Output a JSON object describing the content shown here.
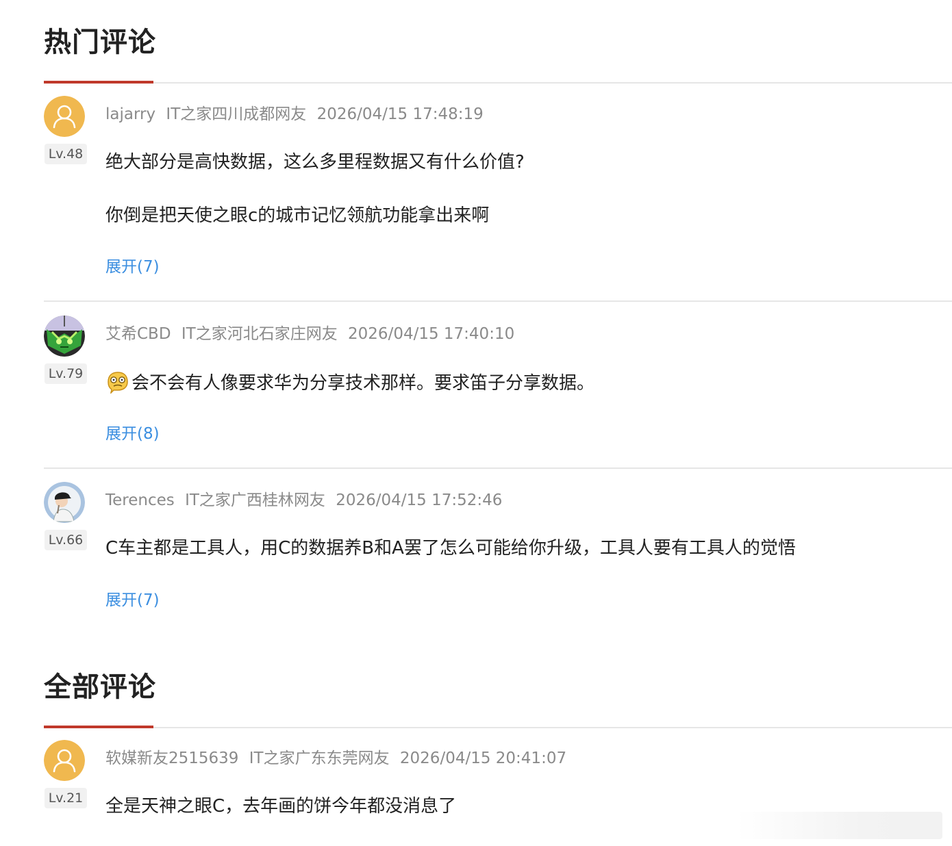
{
  "hot_section": {
    "title": "热门评论"
  },
  "all_section": {
    "title": "全部评论"
  },
  "colors": {
    "accent": "#c0392b",
    "link": "#3b8ee0",
    "meta": "#8a8a8a",
    "avatar_default": "#f0b84f"
  },
  "hot_comments": [
    {
      "username": "lajarry",
      "location": "IT之家四川成都网友",
      "time": "2026/04/15 17:48:19",
      "level": "Lv.48",
      "avatar_icon": "default-user-icon",
      "lines": [
        "绝大部分是高快数据，这么多里程数据又有什么价值?",
        "你倒是把天使之眼c的城市记忆领航功能拿出来啊"
      ],
      "expand": "展开(7)"
    },
    {
      "username": "艾希CBD",
      "location": "IT之家河北石家庄网友",
      "time": "2026/04/15 17:40:10",
      "level": "Lv.79",
      "avatar_icon": "green-mascot-avatar",
      "emoji_icon": "awkward-face-emoji",
      "lines": [
        "会不会有人像要求华为分享技术那样。要求笛子分享数据。"
      ],
      "expand": "展开(8)"
    },
    {
      "username": "Terences",
      "location": "IT之家广西桂林网友",
      "time": "2026/04/15 17:52:46",
      "level": "Lv.66",
      "avatar_icon": "cap-person-avatar",
      "lines": [
        "C车主都是工具人，用C的数据养B和A罢了怎么可能给你升级，工具人要有工具人的觉悟"
      ],
      "expand": "展开(7)"
    }
  ],
  "all_comments": [
    {
      "username": "软媒新友2515639",
      "location": "IT之家广东东莞网友",
      "time": "2026/04/15 20:41:07",
      "level": "Lv.21",
      "avatar_icon": "default-user-icon",
      "lines": [
        "全是天神之眼C，去年画的饼今年都没消息了"
      ]
    }
  ]
}
